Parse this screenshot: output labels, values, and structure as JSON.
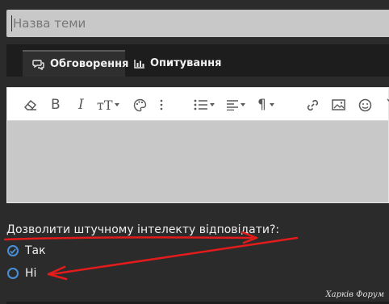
{
  "title_field": {
    "placeholder": "Назва теми",
    "value": ""
  },
  "tabs": [
    {
      "label": "Обговорення",
      "icon": "chat-bubbles-icon",
      "active": true
    },
    {
      "label": "Опитування",
      "icon": "bar-chart-icon",
      "active": false
    }
  ],
  "toolbar": {
    "items": [
      "eraser-icon",
      "bold-icon",
      "italic-icon",
      "text-size-icon",
      "palette-icon",
      "more-vertical-icon",
      "bulleted-list-icon",
      "align-icon",
      "paragraph-icon",
      "link-icon",
      "image-icon",
      "emoji-icon"
    ],
    "glyphs": {
      "bold": "B",
      "italic": "I",
      "text_size": "тT",
      "paragraph": "¶"
    }
  },
  "poll": {
    "question": "Дозволити штучному інтелекту відповідати?:",
    "options": [
      {
        "label": "Так",
        "checked": true
      },
      {
        "label": "Ні",
        "checked": false
      }
    ]
  },
  "watermark": "Харків Форум",
  "colors": {
    "accent": "#4a90d9",
    "annotation": "#e31b1b",
    "background": "#2b2b2b"
  }
}
